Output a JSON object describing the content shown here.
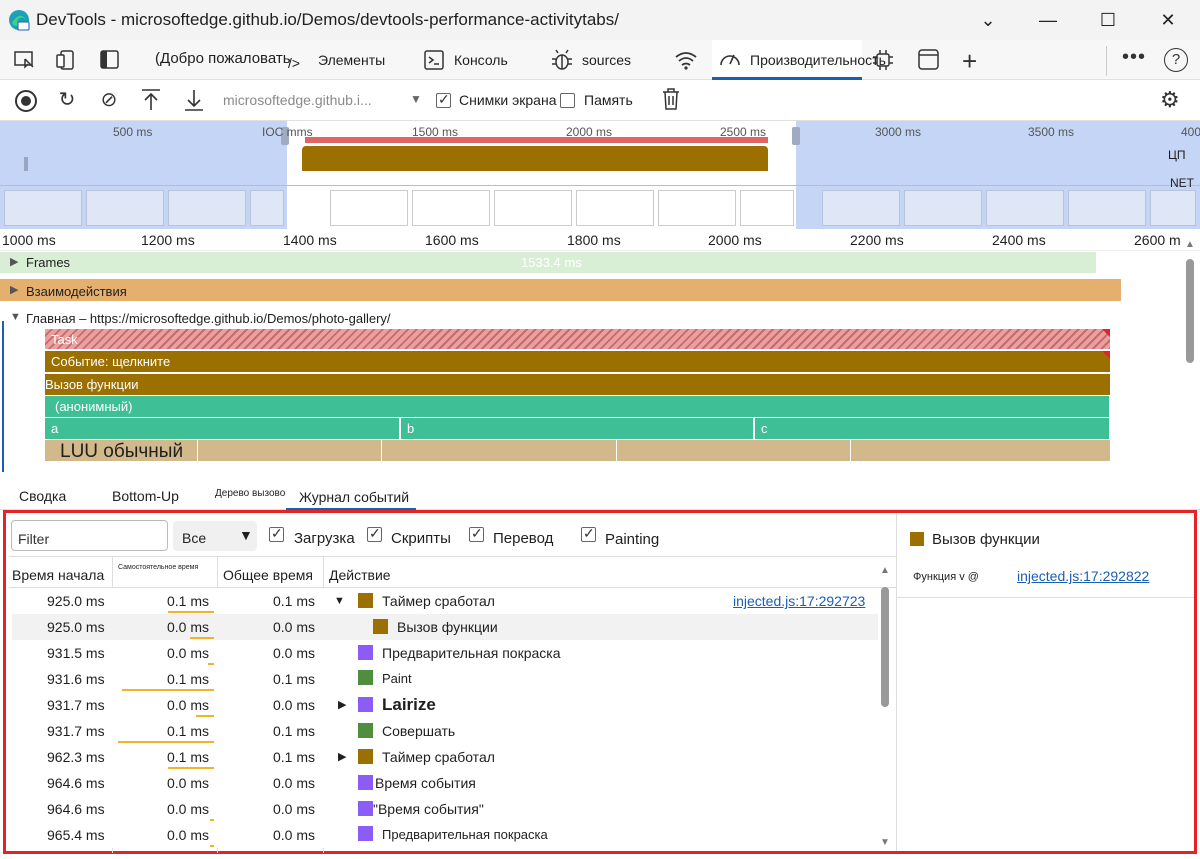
{
  "window": {
    "title": "DevTools - microsoftedge.github.io/Demos/devtools-performance-activitytabs/"
  },
  "tabs": {
    "welcome": "(Добро пожаловать",
    "elements": "Элементы",
    "console": "Консоль",
    "sources": "sources",
    "performance": "Производительность"
  },
  "toolbar": {
    "url": "microsoftedge.github.i...",
    "screenshots_label": "Снимки экрана",
    "memory_label": "Память"
  },
  "overview": {
    "ticks": [
      "500 ms",
      "IOC mms",
      "1500 ms",
      "2000 ms",
      "2500 ms",
      "3000 ms",
      "3500 ms",
      "400"
    ],
    "cpu_label": "ЦП",
    "net_label": "NET"
  },
  "ruler": {
    "ticks": [
      "1000 ms",
      "1200 ms",
      "1400 ms",
      "1600 ms",
      "1800 ms",
      "2000 ms",
      "2200 ms",
      "2400 ms",
      "2600 m"
    ]
  },
  "tracks": {
    "frames_label": "Frames",
    "frames_duration": "1533.4 ms",
    "interactions_label": "Взаимодействия",
    "main_label": "Главная – https://microsoftedge.github.io/Demos/photo-gallery/",
    "task": "Task",
    "event_click": "Событие: щелкните",
    "function_call": "Вызов функции",
    "anonymous": "(анонимный)",
    "a": "a",
    "b": "b",
    "c": "c",
    "luu": "LUU обычный"
  },
  "bottom_tabs": {
    "summary": "Сводка",
    "bottom_up": "Bottom-Up",
    "call_tree": "Дерево вызовов",
    "event_log": "Журнал событий"
  },
  "filters": {
    "filter_placeholder": "Filter",
    "select_value": "Все",
    "loading": "Загрузка",
    "scripting": "Скрипты",
    "rendering": "Перевод",
    "painting": "Painting"
  },
  "table": {
    "headers": {
      "start_time": "Время начала",
      "self_time": "Самостоятельное время",
      "total_time": "Общее время",
      "activity": "Действие"
    },
    "rows": [
      {
        "start": "925.0 ms",
        "self": "0.1 ms",
        "total": "0.1 ms",
        "activity": "Таймер сработал",
        "link": "injected.js:17:292723"
      },
      {
        "start": "925.0 ms",
        "self": "0.0 ms",
        "total": "0.0 ms",
        "activity": "Вызов функции",
        "link": ""
      },
      {
        "start": "931.5 ms",
        "self": "0.0 ms",
        "total": "0.0 ms",
        "activity": "Предварительная покраска",
        "link": ""
      },
      {
        "start": "931.6 ms",
        "self": "0.1 ms",
        "total": "0.1 ms",
        "activity": "Paint",
        "link": ""
      },
      {
        "start": "931.7 ms",
        "self": "0.0 ms",
        "total": "0.0 ms",
        "activity": "Lairize",
        "link": ""
      },
      {
        "start": "931.7 ms",
        "self": "0.1 ms",
        "total": "0.1 ms",
        "activity": "Совершать",
        "link": ""
      },
      {
        "start": "962.3 ms",
        "self": "0.1 ms",
        "total": "0.1 ms",
        "activity": "Таймер сработал",
        "link": ""
      },
      {
        "start": "964.6 ms",
        "self": "0.0 ms",
        "total": "0.0 ms",
        "activity": "Время события",
        "link": ""
      },
      {
        "start": "964.6 ms",
        "self": "0.0 ms",
        "total": "0.0 ms",
        "activity": "\"Время события\"",
        "link": ""
      },
      {
        "start": "965.4 ms",
        "self": "0.0 ms",
        "total": "0.0 ms",
        "activity": "Предварительная покраска",
        "link": ""
      }
    ]
  },
  "details": {
    "title": "Вызов функции",
    "function_label": "Функция v @",
    "function_link": "injected.js:17:292822"
  },
  "colors": {
    "scripting": "#9b6f00",
    "rendering": "#8b5cf6",
    "painting": "#4f8d3f",
    "highlight_border": "#e3222a"
  }
}
